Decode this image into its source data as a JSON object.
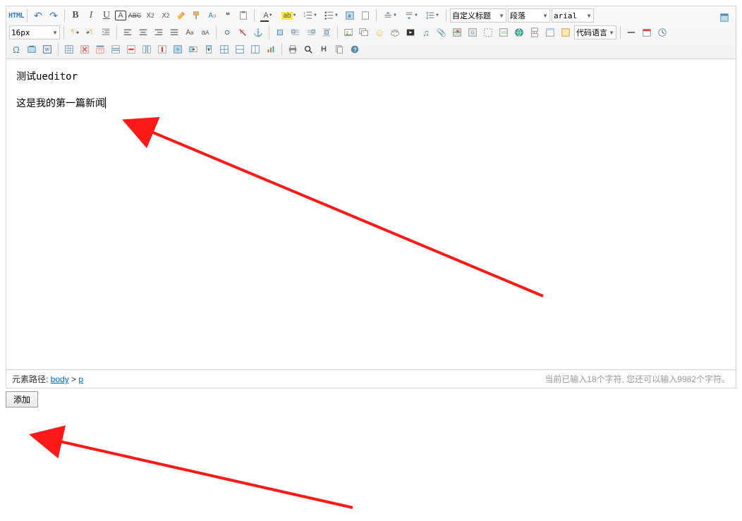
{
  "toolbar": {
    "html_label": "HTML",
    "custom_title": "自定义标题",
    "paragraph": "段落",
    "font_family": "arial",
    "font_size": "16px",
    "code_lang": "代码语言"
  },
  "content": {
    "line1": "测试ueditor",
    "line2": "这是我的第一篇新闻"
  },
  "statusbar": {
    "path_label": "元素路径: ",
    "path_body": "body",
    "path_sep": " > ",
    "path_p": "p",
    "count_text": "当前已输入18个字符, 您还可以输入9982个字符。"
  },
  "buttons": {
    "add": "添加"
  },
  "icons": {
    "undo": "↶",
    "redo": "↷",
    "bold": "B",
    "italic": "I",
    "underline": "U",
    "fontborder": "A",
    "strike": "ABC",
    "sup": "X²",
    "sub": "X₂",
    "eraser": "◢",
    "paste": "✎",
    "format": "Aₐ",
    "quote": "❝",
    "fc": "A",
    "bc": "ab",
    "ltr": "¶◀",
    "rtl": "▶¶",
    "al": "≡",
    "ac": "≡",
    "ar": "≡",
    "aj": "≡",
    "upper": "Aₐ",
    "lower": "aA",
    "link": "🔗",
    "unlink": "✕",
    "anchor": "⚓",
    "img": "🖼",
    "smile": "☺",
    "palette": "🎨",
    "music": "♫",
    "video": "▶",
    "attach": "📎",
    "map": "🗺",
    "gmap": "G",
    "hr": "—",
    "date": "📅",
    "time": "🕐",
    "omega": "Ω",
    "help": "?",
    "table": "▦",
    "fs": "⛶",
    "search": "🔍",
    "print": "🖨"
  }
}
